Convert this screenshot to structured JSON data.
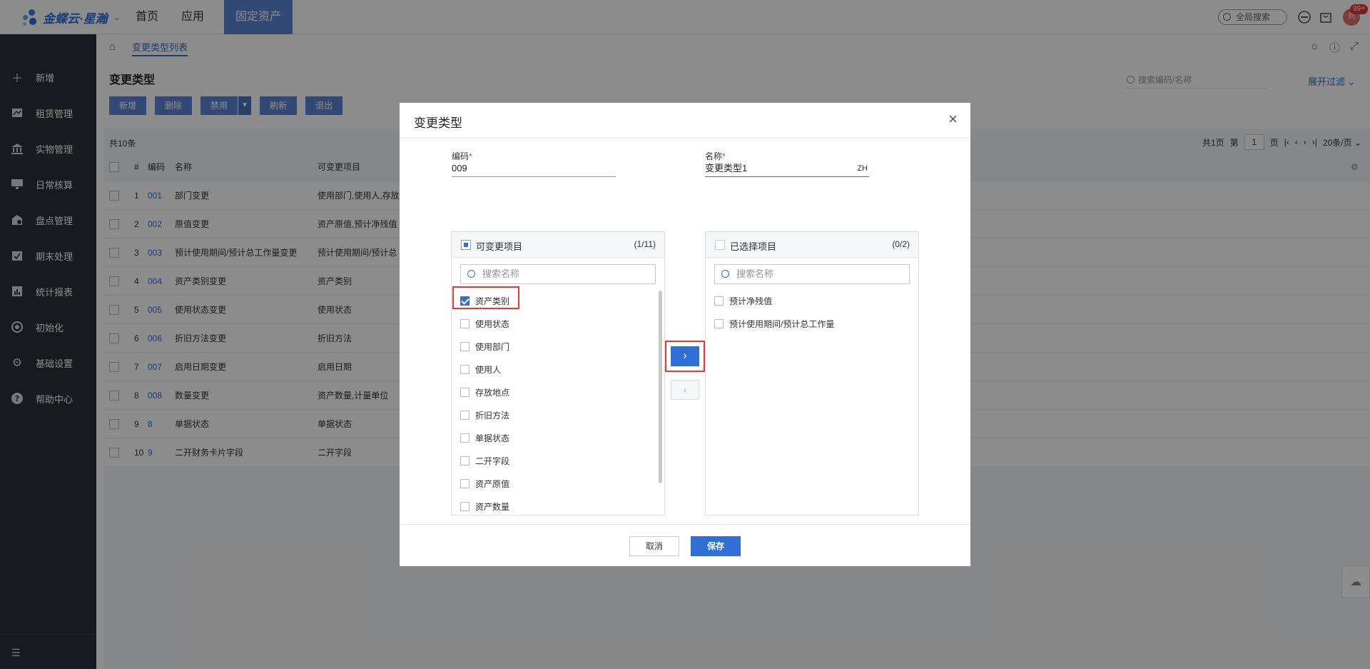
{
  "app": {
    "logo_text": "金蝶云·星瀚",
    "nav": [
      "首页",
      "应用",
      "固定资产"
    ],
    "global_search_placeholder": "全局搜索",
    "avatar_text": "刘",
    "notif_badge": "99+"
  },
  "sidebar": {
    "items": [
      {
        "label": "新增",
        "icon": "plus-icon"
      },
      {
        "label": "租赁管理",
        "icon": "lease-icon"
      },
      {
        "label": "实物管理",
        "icon": "bank-icon"
      },
      {
        "label": "日常核算",
        "icon": "monitor-icon"
      },
      {
        "label": "盘点管理",
        "icon": "inventory-icon"
      },
      {
        "label": "期末处理",
        "icon": "calendar-check-icon"
      },
      {
        "label": "统计报表",
        "icon": "report-icon"
      },
      {
        "label": "初始化",
        "icon": "init-icon"
      },
      {
        "label": "基础设置",
        "icon": "gear-icon"
      },
      {
        "label": "帮助中心",
        "icon": "help-icon"
      }
    ]
  },
  "breadcrumb": {
    "tab": "变更类型列表"
  },
  "page": {
    "title": "变更类型",
    "toolbar": [
      "新增",
      "删除",
      "禁用",
      "刷新",
      "退出"
    ],
    "search_placeholder": "搜索编码/名称",
    "expand_filter": "展开过滤",
    "total": "共10条",
    "pager": {
      "total_pages": "共1页",
      "prefix": "第",
      "page": "1",
      "suffix": "页",
      "page_size": "20条/页"
    },
    "columns": [
      "#",
      "编码",
      "名称",
      "可变更项目"
    ],
    "rows": [
      {
        "n": "1",
        "code": "001",
        "name": "部门变更",
        "items": "使用部门,使用人,存放"
      },
      {
        "n": "2",
        "code": "002",
        "name": "原值变更",
        "items": "资产原值,预计净残值"
      },
      {
        "n": "3",
        "code": "003",
        "name": "预计使用期间/预计总工作量变更",
        "items": "预计使用期间/预计总"
      },
      {
        "n": "4",
        "code": "004",
        "name": "资产类别变更",
        "items": "资产类别"
      },
      {
        "n": "5",
        "code": "005",
        "name": "使用状态变更",
        "items": "使用状态"
      },
      {
        "n": "6",
        "code": "006",
        "name": "折旧方法变更",
        "items": "折旧方法"
      },
      {
        "n": "7",
        "code": "007",
        "name": "启用日期变更",
        "items": "启用日期"
      },
      {
        "n": "8",
        "code": "008",
        "name": "数量变更",
        "items": "资产数量,计量单位"
      },
      {
        "n": "9",
        "code": "8",
        "name": "单据状态",
        "items": "单据状态"
      },
      {
        "n": "10",
        "code": "9",
        "name": "二开财务卡片字段",
        "items": "二开字段"
      }
    ]
  },
  "dialog": {
    "title": "变更类型",
    "code_label": "编码",
    "code_value": "009",
    "name_label": "名称",
    "name_value": "变更类型1",
    "lang_tag": "ZH",
    "left_panel": {
      "title": "可变更项目",
      "count": "(1/11)",
      "search_placeholder": "搜索名称",
      "items": [
        {
          "label": "资产类别",
          "checked": true
        },
        {
          "label": "使用状态",
          "checked": false
        },
        {
          "label": "使用部门",
          "checked": false
        },
        {
          "label": "使用人",
          "checked": false
        },
        {
          "label": "存放地点",
          "checked": false
        },
        {
          "label": "折旧方法",
          "checked": false
        },
        {
          "label": "单据状态",
          "checked": false
        },
        {
          "label": "二开字段",
          "checked": false
        },
        {
          "label": "资产原值",
          "checked": false
        },
        {
          "label": "资产数量",
          "checked": false
        }
      ]
    },
    "right_panel": {
      "title": "已选择项目",
      "count": "(0/2)",
      "search_placeholder": "搜索名称",
      "items": [
        {
          "label": "预计净残值"
        },
        {
          "label": "预计使用期间/预计总工作量"
        }
      ]
    },
    "move_right": "›",
    "move_left": "‹",
    "cancel_label": "取消",
    "save_label": "保存"
  }
}
